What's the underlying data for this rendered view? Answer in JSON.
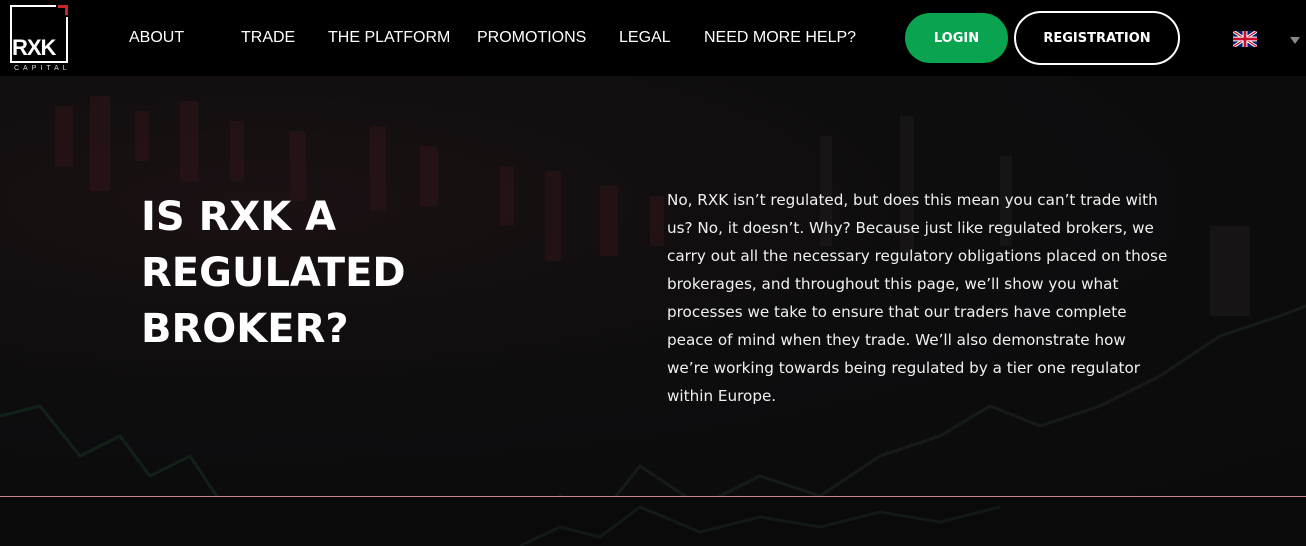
{
  "brand": {
    "logo_text": "RXK",
    "logo_subtext": "CAPITAL",
    "accent_red": "#c8262c"
  },
  "nav": {
    "items": [
      {
        "label": "ABOUT"
      },
      {
        "label": "TRADE"
      },
      {
        "label": "THE PLATFORM"
      },
      {
        "label": "PROMOTIONS"
      },
      {
        "label": "LEGAL"
      },
      {
        "label": "NEED MORE HELP?"
      }
    ]
  },
  "auth": {
    "login_label": "LOGIN",
    "register_label": "REGISTRATION",
    "login_color": "#0aa34f"
  },
  "language": {
    "icon": "uk-flag-icon",
    "caret_icon": "caret-down-icon"
  },
  "hero": {
    "title_lines": [
      "IS RXK A",
      "REGULATED",
      "BROKER?"
    ],
    "body": "No, RXK isn’t regulated, but does this mean you can’t trade with us? No, it doesn’t. Why? Because just like regulated brokers, we carry out all the necessary regulatory obligations placed on those brokerages, and throughout this page, we’ll show you what processes we take to ensure that our traders have complete peace of mind when they trade. We’ll also demonstrate how we’re working towards being regulated by a tier one regulator within Europe."
  }
}
